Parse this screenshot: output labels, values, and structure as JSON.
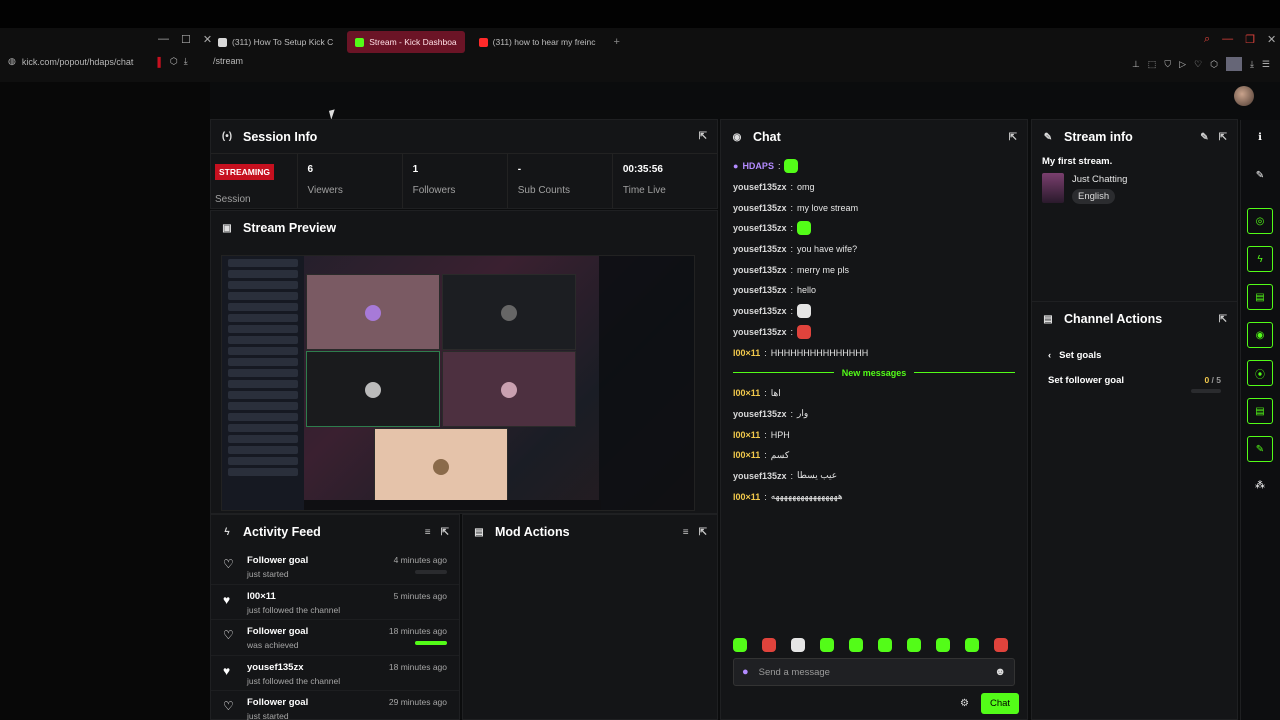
{
  "browser": {
    "tabs": [
      {
        "label": "(311) How To Setup Kick C",
        "active": false,
        "color": "#d8d8d8"
      },
      {
        "label": "Stream - Kick Dashboa",
        "active": true,
        "color": "#53fc18"
      },
      {
        "label": "(311) how to hear my freinc",
        "active": false,
        "color": "#ff2a2a"
      }
    ],
    "newtab": "+",
    "url_left": "kick.com/popout/hdaps/chat",
    "url_right": "/stream"
  },
  "session_info": {
    "title": "Session Info",
    "live_badge": "STREAMING",
    "session_label": "Session",
    "stats": [
      {
        "value": "6",
        "label": "Viewers"
      },
      {
        "value": "1",
        "label": "Followers"
      },
      {
        "value": "-",
        "label": "Sub Counts"
      },
      {
        "value": "00:35:56",
        "label": "Time Live"
      }
    ]
  },
  "stream_preview": {
    "title": "Stream Preview"
  },
  "activity_feed": {
    "title": "Activity Feed",
    "items": [
      {
        "name": "Follower goal",
        "desc": "just started",
        "time": "4 minutes ago",
        "progress": 0,
        "icon": "heart-outline-icon"
      },
      {
        "name": "l00×11",
        "desc": "just followed the channel",
        "time": "5 minutes ago",
        "icon": "heart-filled-icon"
      },
      {
        "name": "Follower goal",
        "desc": "was achieved",
        "time": "18 minutes ago",
        "progress": 1,
        "icon": "heart-outline-icon"
      },
      {
        "name": "yousef135zx",
        "desc": "just followed the channel",
        "time": "18 minutes ago",
        "icon": "heart-filled-icon"
      },
      {
        "name": "Follower goal",
        "desc": "just started",
        "time": "29 minutes ago",
        "icon": "heart-outline-icon"
      }
    ]
  },
  "mod_actions": {
    "title": "Mod Actions"
  },
  "chat": {
    "title": "Chat",
    "messages": [
      {
        "user": "HDAPS",
        "text": "",
        "emote": "green",
        "user_color": "purple"
      },
      {
        "user": "yousef135zx",
        "text": "omg"
      },
      {
        "user": "yousef135zx",
        "text": "my love stream"
      },
      {
        "user": "yousef135zx",
        "text": "",
        "emote": "green"
      },
      {
        "user": "yousef135zx",
        "text": "you have wife?"
      },
      {
        "user": "yousef135zx",
        "text": "merry me pls"
      },
      {
        "user": "yousef135zx",
        "text": "hello"
      },
      {
        "user": "yousef135zx",
        "text": "",
        "emote": "white"
      },
      {
        "user": "yousef135zx",
        "text": "",
        "emote": "red"
      },
      {
        "user": "l00×11",
        "text": "HHHHHHHHHHHHHHH",
        "user_color": "yellow"
      }
    ],
    "new_messages_label": "New messages",
    "new_messages": [
      {
        "user": "l00×11",
        "text": "اها",
        "user_color": "yellow"
      },
      {
        "user": "yousef135zx",
        "text": "وار"
      },
      {
        "user": "l00×11",
        "text": "HPH",
        "user_color": "yellow"
      },
      {
        "user": "l00×11",
        "text": "كسم",
        "user_color": "yellow"
      },
      {
        "user": "yousef135zx",
        "text": "عيب يسطا"
      },
      {
        "user": "l00×11",
        "text": "ههههههههههههههههه",
        "user_color": "yellow"
      }
    ],
    "input_placeholder": "Send a message",
    "send_label": "Chat"
  },
  "stream_info": {
    "title": "Stream info",
    "stream_title": "My first stream.",
    "category": "Just Chatting",
    "language": "English"
  },
  "channel_actions": {
    "title": "Channel Actions",
    "back_label": "Set goals",
    "goal_label": "Set follower goal",
    "goal_current": "0",
    "goal_total": "/ 5"
  },
  "colors": {
    "accent": "#53fc18",
    "live": "#c6101f",
    "panel": "#141517"
  }
}
